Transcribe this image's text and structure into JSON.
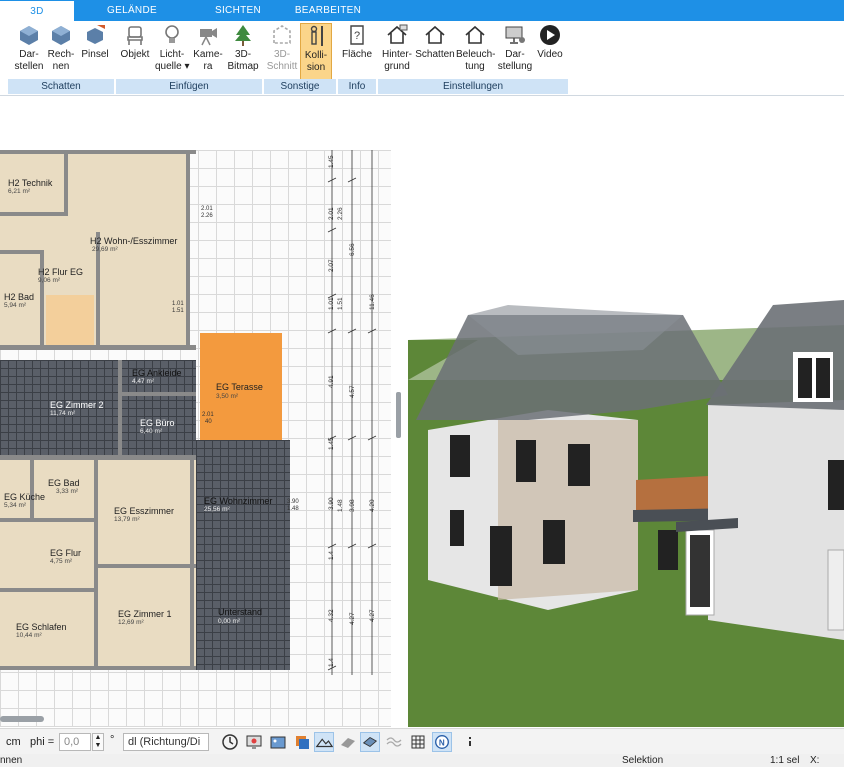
{
  "tabs": [
    "3D",
    "GELÄNDE",
    "SICHTEN",
    "BEARBEITEN"
  ],
  "ribbon": {
    "buttons": [
      {
        "label": "Dar-\nstellen",
        "icon": "cube-display-icon"
      },
      {
        "label": "Rech-\nnen",
        "icon": "cube-compute-icon"
      },
      {
        "label": "Pinsel",
        "icon": "cube-brush-icon"
      },
      {
        "label": "Objekt",
        "icon": "chair-icon"
      },
      {
        "label": "Licht-\nquelle ▾",
        "icon": "lightbulb-icon"
      },
      {
        "label": "Kame-\nra",
        "icon": "camera-icon"
      },
      {
        "label": "3D-\nBitmap",
        "icon": "tree-icon"
      },
      {
        "label": "3D-\nSchnitt",
        "icon": "section-icon"
      },
      {
        "label": "Kolli-\nsion",
        "icon": "person-collision-icon"
      },
      {
        "label": "Fläche",
        "icon": "area-question-icon"
      },
      {
        "label": "Hinter-\ngrund",
        "icon": "house-background-icon"
      },
      {
        "label": "Schatten",
        "icon": "house-shadow-icon"
      },
      {
        "label": "Beleuch-\ntung",
        "icon": "house-light-icon"
      },
      {
        "label": "Dar-\nstellung",
        "icon": "monitor-icon"
      },
      {
        "label": "Video",
        "icon": "play-icon"
      }
    ],
    "groups": [
      "Schatten",
      "Einfügen",
      "Sonstige",
      "Info",
      "Einstellungen"
    ]
  },
  "plan": {
    "rooms": [
      {
        "name": "H2 Technik",
        "area": "6,21 m²"
      },
      {
        "name": "H2 Wohn-/Esszimmer",
        "area": "29,69 m²"
      },
      {
        "name": "H2 Flur EG",
        "area": "9,06 m²"
      },
      {
        "name": "H2 Bad",
        "area": "5,94 m²"
      },
      {
        "name": "EG Ankleide",
        "area": "4,47 m²"
      },
      {
        "name": "EG Zimmer 2",
        "area": "11,74 m²"
      },
      {
        "name": "EG Büro",
        "area": "6,40 m²"
      },
      {
        "name": "EG Terasse",
        "area": "3,50 m²"
      },
      {
        "name": "EG Bad",
        "area": "3,33 m²"
      },
      {
        "name": "EG Küche",
        "area": "5,34 m²"
      },
      {
        "name": "EG Esszimmer",
        "area": "13,79 m²"
      },
      {
        "name": "EG Wohnzimmer",
        "area": "25,56 m²"
      },
      {
        "name": "EG Flur",
        "area": "4,75 m²"
      },
      {
        "name": "EG Zimmer 1",
        "area": "12,69 m²"
      },
      {
        "name": "Unterstand",
        "area": "0,00 m²"
      },
      {
        "name": "EG Schlafen",
        "area": "10,44 m²"
      }
    ],
    "dims_v1": [
      "1.45",
      "2.01",
      "2.07",
      "1.01",
      "4.91",
      "1.45",
      "3.90",
      "1.4",
      "4.32",
      "1.4"
    ],
    "dims_v2": [
      "2.26",
      "6.56",
      "1.51",
      "4.57",
      "1.48",
      "3.98",
      "4.27"
    ],
    "dims_v3": [
      "11.46",
      "4.20",
      "4.27"
    ],
    "small_dims": [
      "2.01",
      "2.26",
      "1.01",
      "1.51",
      "3.90",
      "1.48",
      "2.01",
      "40"
    ]
  },
  "toolbar": {
    "unit": "cm",
    "phi_label": "phi =",
    "phi_value": "0,0",
    "deg": "°",
    "direction": "dl (Richtung/Di"
  },
  "status": {
    "left": "nnen",
    "mode": "Selektion",
    "scale": "1:1 sel",
    "x": "X:"
  },
  "colors": {
    "accent": "#1e90e6",
    "terrace": "#f39a3e",
    "room_fill": "#e9dcc2",
    "tile": "#5a5f68",
    "grass": "#5f8a3a"
  }
}
